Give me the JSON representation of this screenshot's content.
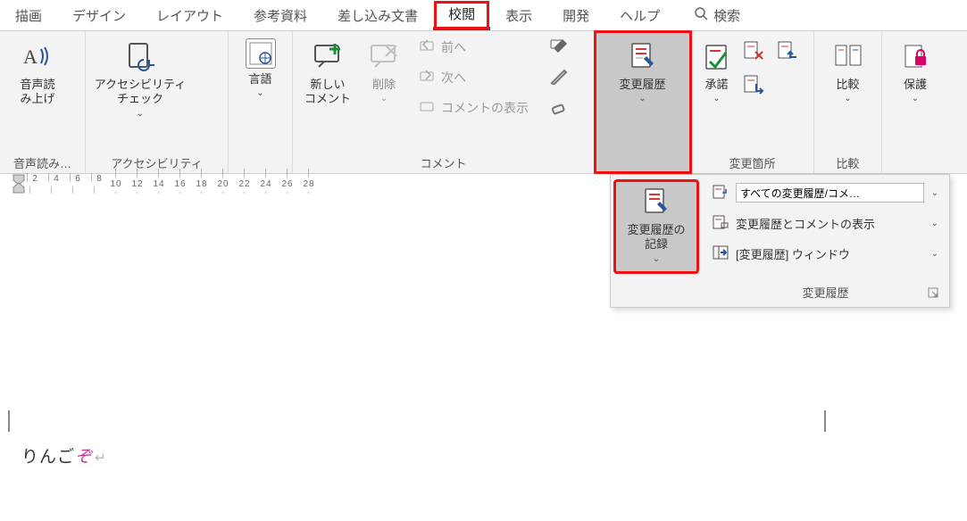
{
  "tabs": {
    "draw": "描画",
    "design": "デザイン",
    "layout": "レイアウト",
    "references": "参考資料",
    "mailings": "差し込み文書",
    "review": "校閲",
    "view": "表示",
    "developer": "開発",
    "help": "ヘルプ",
    "search": "検索"
  },
  "groups": {
    "speech": {
      "button": "音声読\nみ上げ",
      "label": "音声読み…"
    },
    "accessibility": {
      "button": "アクセシビリティ\nチェック",
      "label": "アクセシビリティ"
    },
    "language": {
      "button": "言語"
    },
    "comments": {
      "new": "新しい\nコメント",
      "delete": "削除",
      "previous": "前へ",
      "next": "次へ",
      "show": "コメントの表示",
      "label": "コメント"
    },
    "tracking": {
      "button": "変更履歴",
      "accept": "承諾",
      "compare": "比較",
      "protect": "保護",
      "changes_label": "変更箇所",
      "compare_label": "比較"
    }
  },
  "dropdown": {
    "record": "変更履歴の\n記録",
    "display_select": "すべての変更履歴/コメ…",
    "show_markup": "変更履歴とコメントの表示",
    "pane": "[変更履歴] ウィンドウ",
    "footer": "変更履歴"
  },
  "ruler": [
    "2",
    "4",
    "6",
    "8",
    "10",
    "12",
    "14",
    "16",
    "18",
    "20",
    "22",
    "24",
    "26",
    "28"
  ],
  "document": {
    "base_text": "りんご",
    "inserted_text": "ぞ",
    "paragraph_mark": "↵"
  }
}
